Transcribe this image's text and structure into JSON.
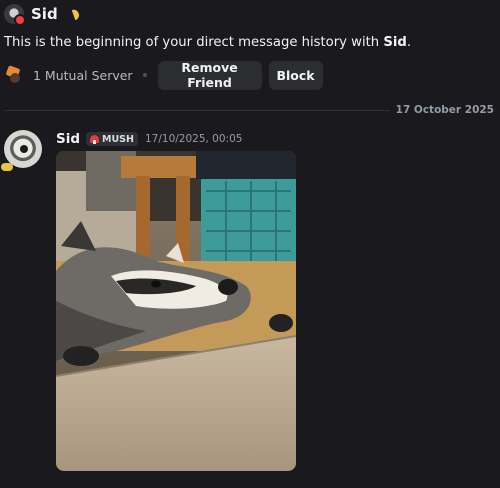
{
  "header": {
    "name": "Sid",
    "status_color": "#f23f43"
  },
  "intro": {
    "prefix": "This is the beginning of your direct message history with ",
    "name": "Sid",
    "suffix": "."
  },
  "profile_actions": {
    "mutual_servers": "1 Mutual Server",
    "remove_friend_label": "Remove Friend",
    "block_label": "Block"
  },
  "date_divider": "17 October 2025",
  "message": {
    "author": "Sid",
    "tag": "MUSH",
    "timestamp": "17/10/2025, 00:05",
    "attachment": {
      "type": "image",
      "icon": "raccoon-photo"
    }
  },
  "colors": {
    "background": "#1a1a1e",
    "button_bg": "#2b2d31",
    "muted_text": "#949ba4"
  }
}
